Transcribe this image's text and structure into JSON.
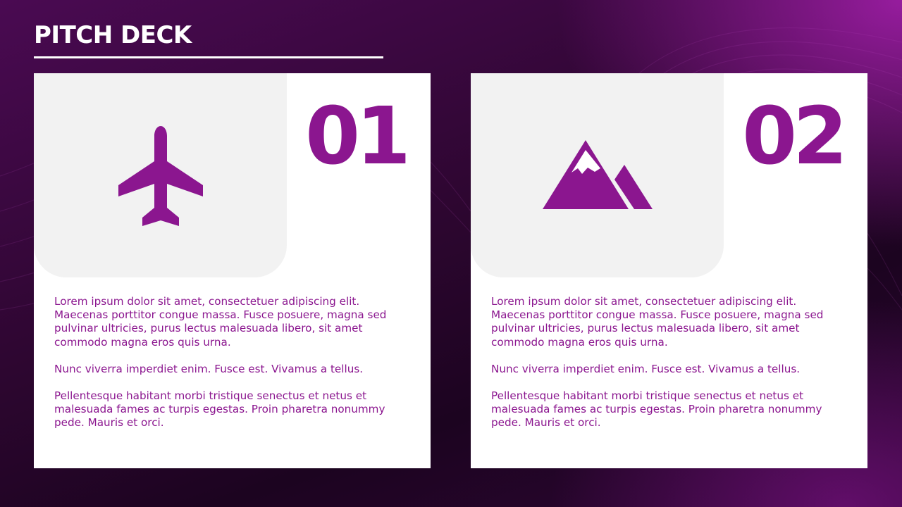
{
  "slide": {
    "title": "PITCH DECK"
  },
  "colors": {
    "accent": "#8b168f",
    "card_background": "#ffffff",
    "icon_panel_background": "#f2f2f2",
    "title_text": "#ffffff"
  },
  "cards": [
    {
      "number": "01",
      "icon": "airplane-icon",
      "paragraphs": [
        "Lorem ipsum dolor sit amet, consectetuer adipiscing elit. Maecenas porttitor congue massa. Fusce posuere, magna sed pulvinar ultricies, purus lectus malesuada libero, sit amet commodo magna eros quis urna.",
        "Nunc viverra imperdiet enim. Fusce est. Vivamus a tellus.",
        "Pellentesque habitant morbi tristique senectus et netus et malesuada fames ac turpis egestas. Proin pharetra nonummy pede. Mauris et orci."
      ]
    },
    {
      "number": "02",
      "icon": "mountain-icon",
      "paragraphs": [
        "Lorem ipsum dolor sit amet, consectetuer adipiscing elit. Maecenas porttitor congue massa. Fusce posuere, magna sed pulvinar ultricies, purus lectus malesuada libero, sit amet commodo magna eros quis urna.",
        "Nunc viverra imperdiet enim. Fusce est. Vivamus a tellus.",
        "Pellentesque habitant morbi tristique senectus et netus et malesuada fames ac turpis egestas. Proin pharetra nonummy pede. Mauris et orci."
      ]
    }
  ]
}
